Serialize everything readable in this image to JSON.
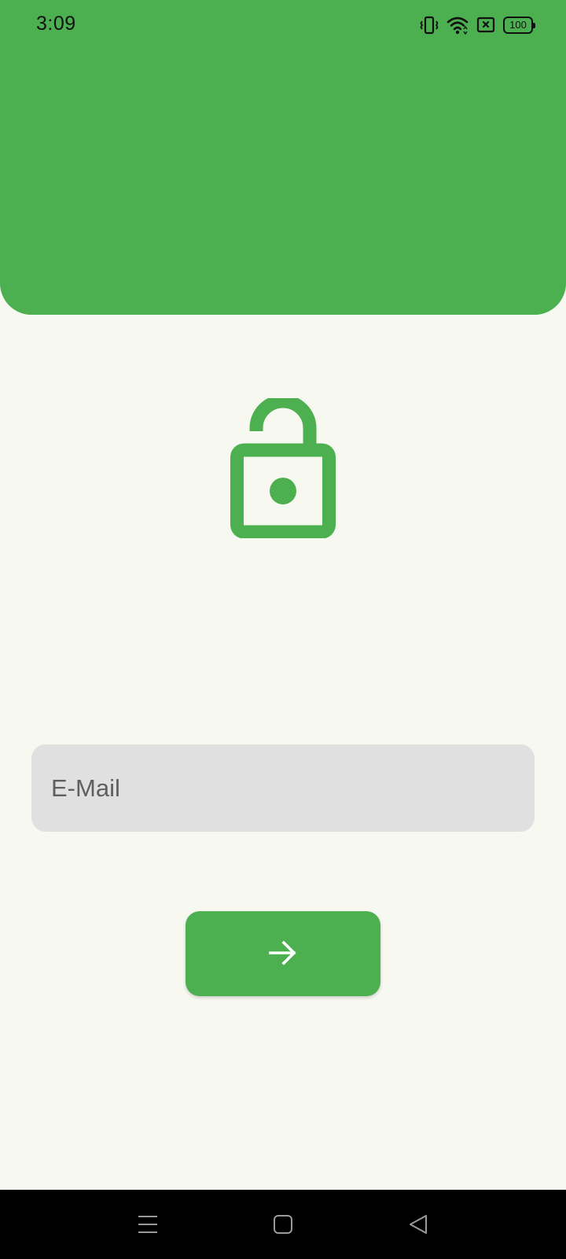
{
  "status_bar": {
    "time": "3:09",
    "battery_level": "100",
    "icons": [
      "vibrate-icon",
      "wifi-icon",
      "no-sim-icon",
      "battery-icon"
    ]
  },
  "colors": {
    "accent": "#4caf50",
    "background": "#f7f9f1",
    "input_background": "#e0e0e0",
    "nav_bar": "#000000"
  },
  "main": {
    "lock_icon": "unlocked-padlock-icon",
    "email": {
      "placeholder": "E-Mail",
      "value": ""
    },
    "submit_icon": "arrow-right-icon"
  },
  "nav_bar": {
    "buttons": [
      "menu-icon",
      "home-icon",
      "back-icon"
    ]
  }
}
